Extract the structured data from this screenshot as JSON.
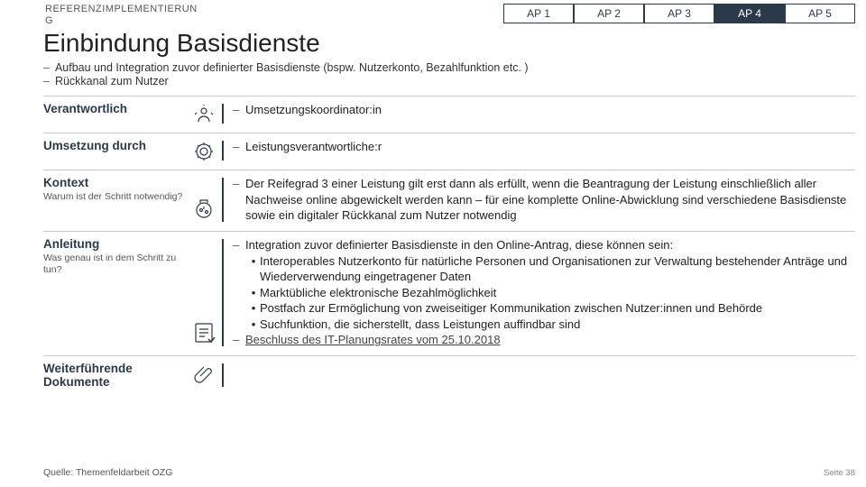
{
  "header": {
    "ref_label": "REFERENZIMPLEMENTIERUNG",
    "tabs": [
      {
        "label": "AP 1",
        "active": false
      },
      {
        "label": "AP 2",
        "active": false
      },
      {
        "label": "AP 3",
        "active": false
      },
      {
        "label": "AP 4",
        "active": true
      },
      {
        "label": "AP 5",
        "active": false
      }
    ]
  },
  "title": "Einbindung Basisdienste",
  "intro": [
    "Aufbau und Integration zuvor definierter Basisdienste (bspw. Nutzerkonto, Bezahlfunktion etc. )",
    "Rückkanal zum Nutzer"
  ],
  "rows": {
    "verantwortlich": {
      "label": "Verantwortlich",
      "content": "Umsetzungskoordinator:in"
    },
    "umsetzung": {
      "label": "Umsetzung durch",
      "content": "Leistungsverantwortliche:r"
    },
    "kontext": {
      "label": "Kontext",
      "sub": "Warum ist der Schritt notwendig?",
      "content": "Der Reifegrad 3 einer Leistung gilt erst dann als erfüllt, wenn die Beantragung der Leistung einschließlich aller Nachweise online abgewickelt werden kann – für eine komplette Online-Abwicklung sind verschiedene Basisdienste sowie ein digitaler Rückkanal zum Nutzer notwendig"
    },
    "anleitung": {
      "label": "Anleitung",
      "sub": "Was genau ist in dem Schritt zu tun?",
      "lead": "Integration zuvor definierter Basisdienste in den Online-Antrag, diese können sein:",
      "bullets": [
        "Interoperables Nutzerkonto für natürliche Personen und Organisationen zur Verwaltung bestehender Anträge und Wiederverwendung eingetragener Daten",
        "Marktübliche elektronische Bezahlmöglichkeit",
        "Postfach zur Ermöglichung von zweiseitiger Kommunikation zwischen Nutzer:innen und Behörde",
        "Suchfunktion, die sicherstellt, dass Leistungen auffindbar sind"
      ],
      "link": "Beschluss des IT-Planungsrates vom 25.10.2018"
    },
    "docs": {
      "label": "Weiterführende Dokumente"
    }
  },
  "footer": {
    "source": "Quelle: Themenfeldarbeit OZG",
    "page": "Seite 38"
  }
}
